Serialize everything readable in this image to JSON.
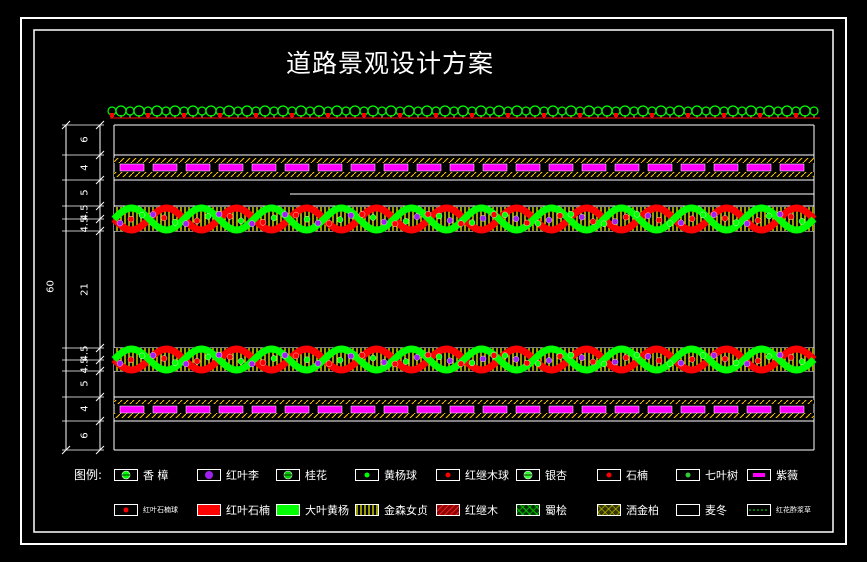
{
  "title": "道路景观设计方案",
  "overall_dimension": "60",
  "dimension_labels": [
    "6",
    "4",
    "5",
    "4.5",
    "4.5",
    "21",
    "4.5",
    "4.5",
    "5",
    "4",
    "6"
  ],
  "legend": {
    "heading": "图例:",
    "row1": [
      {
        "label": "香 樟",
        "icon": "tree-symbol",
        "color": "#00ff00"
      },
      {
        "label": "红叶李",
        "icon": "purple-circle",
        "color": "#a020f0"
      },
      {
        "label": "桂花",
        "icon": "tree-symbol",
        "color": "#00cc00"
      },
      {
        "label": "黄杨球",
        "icon": "green-dot",
        "color": "#00ff00"
      },
      {
        "label": "红继木球",
        "icon": "red-dot",
        "color": "#ff0000"
      },
      {
        "label": "银杏",
        "icon": "tree-symbol",
        "color": "#33ff33"
      },
      {
        "label": "石楠",
        "icon": "red-dot",
        "color": "#ff0000"
      },
      {
        "label": "七叶树",
        "icon": "green-dot",
        "color": "#33cc33"
      },
      {
        "label": "紫薇",
        "icon": "magenta-bar",
        "color": "#ff00ff"
      }
    ],
    "row2": [
      {
        "label": "红叶石楠球",
        "icon": "red-dot",
        "color": "#ff0000",
        "small": true
      },
      {
        "label": "红叶石楠",
        "icon": "red-fill",
        "color": "#ff0000"
      },
      {
        "label": "大叶黄杨",
        "icon": "green-fill",
        "color": "#00ff00"
      },
      {
        "label": "金森女贞",
        "icon": "yellow-hatch",
        "color": "#ffff00"
      },
      {
        "label": "红继木",
        "icon": "darkred-hatch",
        "color": "#c00000"
      },
      {
        "label": "蜀桧",
        "icon": "green-cross",
        "color": "#00aa00"
      },
      {
        "label": "洒金柏",
        "icon": "yellow-cross",
        "color": "#cccc00"
      },
      {
        "label": "麦冬",
        "icon": "empty-box",
        "color": "#000000"
      },
      {
        "label": "红花酢浆草",
        "icon": "dotted-box",
        "color": "#00ff00",
        "small": true
      }
    ]
  }
}
